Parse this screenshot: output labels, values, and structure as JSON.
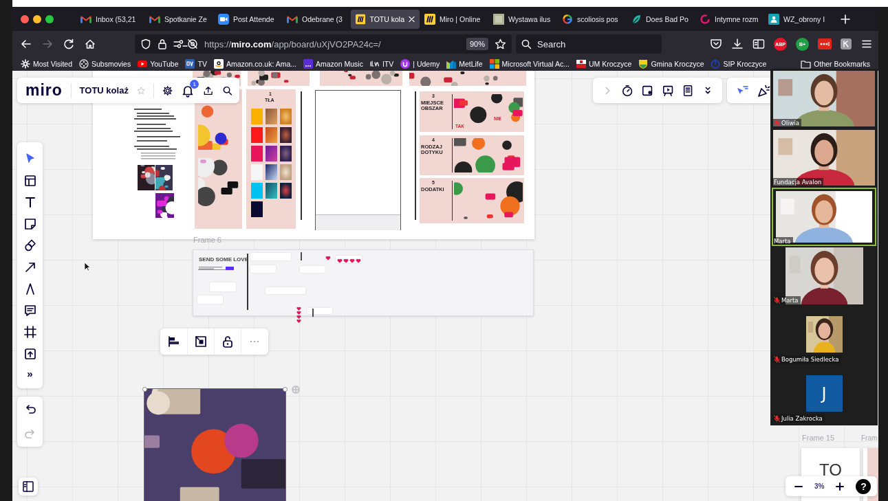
{
  "browser": {
    "tabs": [
      {
        "title": "Inbox (53,21",
        "selected": false
      },
      {
        "title": "Spotkanie Ze",
        "selected": false
      },
      {
        "title": "Post Attende",
        "selected": false
      },
      {
        "title": "Odebrane (3",
        "selected": false
      },
      {
        "title": "TOTU kola",
        "selected": true
      },
      {
        "title": "Miro | Online",
        "selected": false
      },
      {
        "title": "Wystawa ilus",
        "selected": false
      },
      {
        "title": "scoliosis pos",
        "selected": false
      },
      {
        "title": "Does Bad Po",
        "selected": false
      },
      {
        "title": "Intymne rozm",
        "selected": false
      },
      {
        "title": "WZ_obrony I",
        "selected": false
      }
    ],
    "forward_disabled": true,
    "url": "https://**miro.com**/app/board/uXjVO2PA24c=/",
    "page_zoom": "90%",
    "search_placeholder": "Search",
    "extensions": [
      {
        "kind": "pocket"
      },
      {
        "kind": "download"
      },
      {
        "kind": "sidebar"
      },
      {
        "kind": "round-badge",
        "label": "ABP",
        "color": "#e8132b"
      },
      {
        "kind": "round-badge",
        "label": "B+",
        "color": "#1e9e45"
      },
      {
        "kind": "dots"
      },
      {
        "kind": "tile"
      }
    ],
    "bookmarks": [
      "Most Visited",
      "Subsmovies",
      "YouTube",
      "TV",
      "Amazon.co.uk: Ama...",
      "Amazon Music",
      "ITV",
      "| Udemy",
      "MetLife",
      "Microsoft Virtual Ac...",
      "UM Kroczyce",
      "Gmina Kroczyce",
      "SIP Kroczyce"
    ],
    "other_bookmarks": "Other Bookmarks"
  },
  "miro": {
    "logo": "miro",
    "board_title": "TOTU kolaż",
    "starred": false,
    "notifications": "1",
    "collab_tools": [
      {
        "kind": "expand"
      },
      {
        "kind": "timer"
      },
      {
        "kind": "card"
      },
      {
        "kind": "present"
      },
      {
        "kind": "notes"
      },
      {
        "kind": "collapse"
      }
    ],
    "reactions": [
      {
        "kind": "cursors"
      },
      {
        "kind": "celebrate"
      }
    ],
    "tools": [
      {
        "kind": "select",
        "selected": true
      },
      {
        "kind": "templates",
        "selected": false
      },
      {
        "kind": "text",
        "selected": false
      },
      {
        "kind": "sticky",
        "selected": false
      },
      {
        "kind": "shapes",
        "selected": false
      },
      {
        "kind": "line",
        "selected": false
      },
      {
        "kind": "pen",
        "selected": false
      },
      {
        "kind": "comment",
        "selected": false
      },
      {
        "kind": "frame",
        "selected": false
      },
      {
        "kind": "upload",
        "selected": false
      }
    ],
    "more_tools": "»",
    "redo_disabled": true,
    "selection_toolbar": [
      {
        "kind": "align"
      },
      {
        "kind": "fit"
      },
      {
        "kind": "unlock"
      },
      {
        "kind": "more"
      }
    ],
    "zoom": "3%",
    "help": "?",
    "board": {
      "background_column": {
        "number": "1",
        "title": "TŁA"
      },
      "sections": [
        {
          "number": "3",
          "title": "MIEJSCE OBSZAR",
          "tags": [
            "TAK",
            "NIE"
          ]
        },
        {
          "number": "4",
          "title": "RODZAJ DOTYKU"
        },
        {
          "number": "5",
          "title": "DODATKI"
        }
      ],
      "love_frame": {
        "label": "Frame 6",
        "heading": "SEND SOME LOVE"
      },
      "letter_frame": {
        "label": "Frame 15",
        "text": "TO"
      },
      "next_frame": {
        "label": "Fram"
      }
    }
  },
  "meeting": {
    "participants": [
      {
        "name": "Oliwia",
        "kind": "video",
        "muted": true,
        "speaking": false
      },
      {
        "name": "Fundacja Avalon",
        "kind": "video",
        "muted": false,
        "speaking": false
      },
      {
        "name": "Marta",
        "kind": "video",
        "muted": false,
        "speaking": true
      },
      {
        "name": "Marta",
        "kind": "portrait",
        "muted": true,
        "speaking": false
      },
      {
        "name": "Bogumiła Siedlecka",
        "muted": true,
        "speaking": false
      },
      {
        "name": "Julia Zakrocka",
        "kind": "initial",
        "initial": "J",
        "muted": true,
        "speaking": false
      }
    ]
  }
}
